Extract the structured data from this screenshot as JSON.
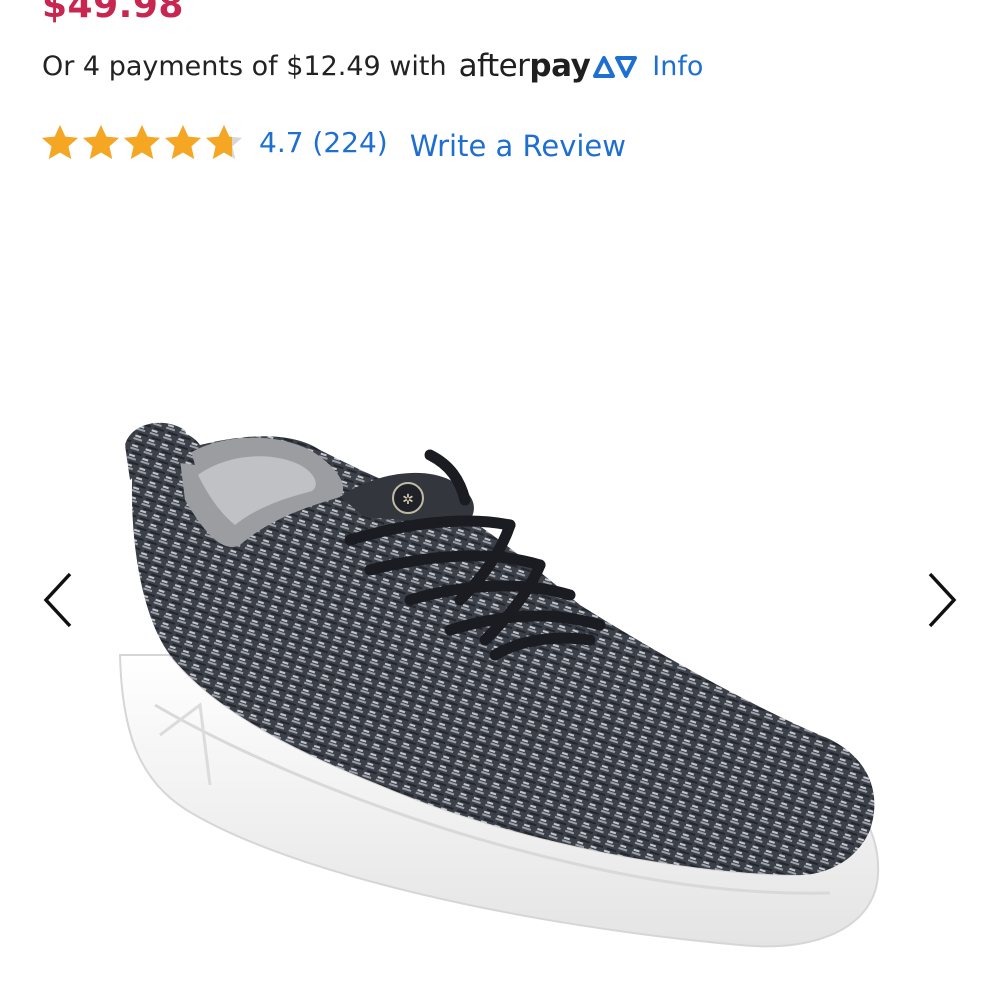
{
  "colors": {
    "price": "#c8254f",
    "link": "#1f6fd1",
    "star": "#f5a623",
    "text": "#222222",
    "afterpay_mark": "#1f6fd1"
  },
  "product": {
    "price": "$49.98",
    "payments": {
      "text": "Or 4 payments of $12.49 with",
      "provider_light": "after",
      "provider_bold": "pay",
      "info_link": "Info"
    },
    "rating": {
      "value": 4.7,
      "max": 5,
      "text": "4.7 (224)",
      "write_review": "Write a Review"
    },
    "image": {
      "icon": "sneaker-product-image"
    },
    "carousel": {
      "prev_icon": "chevron-left-icon",
      "next_icon": "chevron-right-icon"
    }
  }
}
